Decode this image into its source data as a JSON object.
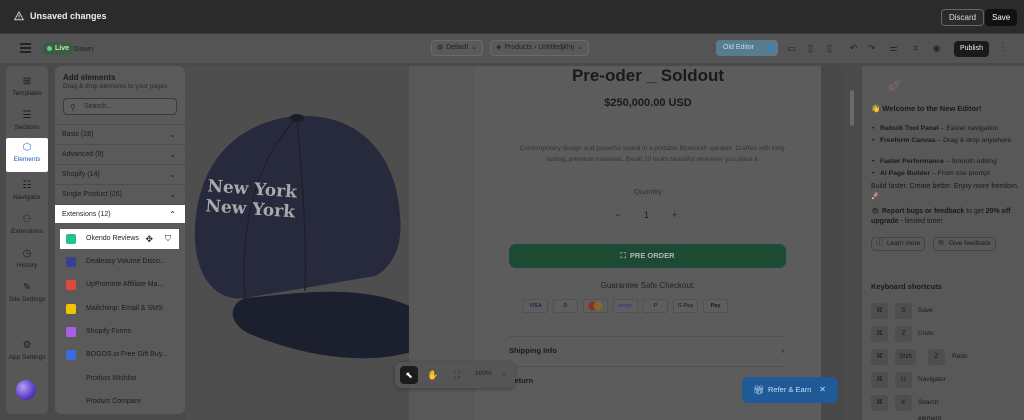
{
  "topbar": {
    "unsaved": "Unsaved changes",
    "discard": "Discard",
    "save": "Save"
  },
  "header": {
    "live": "Live",
    "theme": "Dawn",
    "template_default": "Default",
    "breadcrumb": "Products  ›  Untitledjkhij",
    "old_editor": "Old Editor",
    "publish": "Publish"
  },
  "rail": {
    "items": [
      {
        "label": "Templates",
        "icon": "templates-icon"
      },
      {
        "label": "Sections",
        "icon": "sections-icon"
      },
      {
        "label": "Elements",
        "icon": "elements-icon"
      },
      {
        "label": "Navigator",
        "icon": "navigator-icon"
      },
      {
        "label": "Extensions",
        "icon": "extensions-icon"
      },
      {
        "label": "History",
        "icon": "history-icon"
      },
      {
        "label": "Site Settings",
        "icon": "site-settings-icon"
      },
      {
        "label": "App Settings",
        "icon": "app-settings-icon"
      }
    ]
  },
  "panel": {
    "title": "Add elements",
    "subtitle": "Drag & drop elements to your pages",
    "search_placeholder": "Search...",
    "categories": [
      "Basic (28)",
      "Advanced (9)",
      "Shopify (14)",
      "Single Product (26)",
      "Extensions (12)"
    ],
    "extensions": [
      {
        "label": "Okendo Reviews",
        "color": "#25c28a"
      },
      {
        "label": "Dealeasy Volume Disco...",
        "color": "#3b3f8f"
      },
      {
        "label": "UpPromote Affiliate Ma...",
        "color": "#e0483b"
      },
      {
        "label": "Mailchimp: Email & SMS",
        "color": "#f2c300"
      },
      {
        "label": "Shopify Forms",
        "color": "#a85ee8"
      },
      {
        "label": "BOGOS.io Free Gift Buy...",
        "color": "#3b6be0"
      },
      {
        "label": "Product Wishlist",
        "color": "#5a5a5a"
      },
      {
        "label": "Product Compare",
        "color": "#5a5a5a"
      }
    ]
  },
  "product": {
    "title": "Pre-oder _ Soldout",
    "price": "$250,000.00 USD",
    "description": "Contemporary design and powerful sound in a portable Bluetooth speaker. Crafted with long-lasting, premium materials, Beolit 20 looks beautiful wherever you place it.",
    "quantity_label": "Quantity",
    "quantity": "1",
    "preorder": "PRE ORDER",
    "safe_checkout": "Guarantee Safe Checkout:",
    "payments": [
      "VISA",
      "D",
      "MC",
      "stripe",
      "P",
      "G Pay",
      "Pay"
    ],
    "shipping": "Shipping Info",
    "return": "Return",
    "cap_text_1": "New York",
    "cap_text_2": "New York"
  },
  "toolbar": {
    "zoom": "100%"
  },
  "refer": {
    "label": "Refer & Earn"
  },
  "right": {
    "welcome": "👋 Welcome to the New Editor!",
    "features": [
      {
        "bold": "Rebuilt Tool Panel",
        "rest": " – Easier navigation"
      },
      {
        "bold": "Freeform Canvas",
        "rest": " – Drag & drop anywhere"
      },
      {
        "bold": "Faster Performance",
        "rest": " – Smooth editing"
      },
      {
        "bold": "AI Page Builder",
        "rest": " – From one prompt"
      }
    ],
    "tagline": "Build faster. Create better. Enjoy more freedom. 🚀",
    "report_bold": "Report bugs or feedback",
    "report_mid": " to get ",
    "report_bold2": "20% off upgrade",
    "report_end": " - limited time!",
    "learn_more": "Learn more",
    "give_feedback": "Give feedback",
    "shortcuts_title": "Keyboard shortcuts",
    "shortcuts": [
      {
        "keys": [
          "⌘",
          "S"
        ],
        "desc": "Save"
      },
      {
        "keys": [
          "⌘",
          "Z"
        ],
        "desc": "Undo"
      },
      {
        "keys": [
          "⌘",
          "Shift",
          "Z"
        ],
        "desc": "Redo"
      },
      {
        "keys": [
          "⌘",
          "U"
        ],
        "desc": "Navigator"
      },
      {
        "keys": [
          "⌘",
          "K"
        ],
        "desc": "Search element"
      }
    ]
  }
}
